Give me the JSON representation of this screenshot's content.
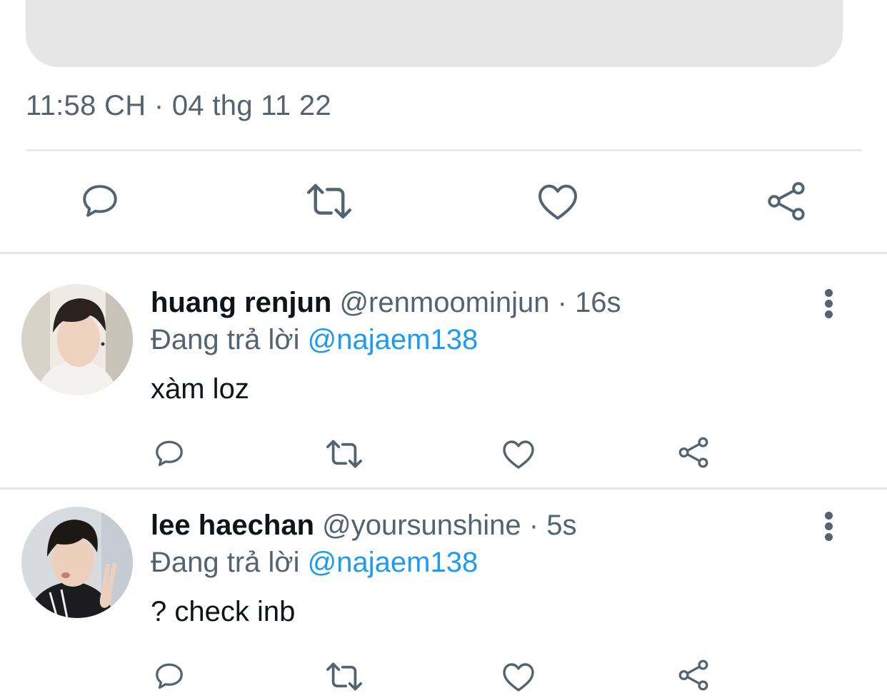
{
  "tweet": {
    "timestamp": "11:58 CH · 04 thg 11 22",
    "actions": [
      {
        "icon": "reply-icon"
      },
      {
        "icon": "retweet-icon"
      },
      {
        "icon": "like-icon"
      },
      {
        "icon": "share-icon"
      }
    ]
  },
  "replies": [
    {
      "name": "huang renjun",
      "handle": "@renmoominjun",
      "separator": " · ",
      "time": "16s",
      "replying_label": "Đang trả lời",
      "replying_to": "@najaem138",
      "text": "xàm loz"
    },
    {
      "name": "lee haechan",
      "handle": "@yoursunshine",
      "separator": " · ",
      "time": "5s",
      "replying_label": "Đang trả lời",
      "replying_to": "@najaem138",
      "text": "? check inb"
    }
  ],
  "colors": {
    "text_primary": "#0f1419",
    "text_secondary": "#536471",
    "mention": "#1d9bf0",
    "divider": "#e6e6e6",
    "media_placeholder": "#e6e6e6"
  }
}
